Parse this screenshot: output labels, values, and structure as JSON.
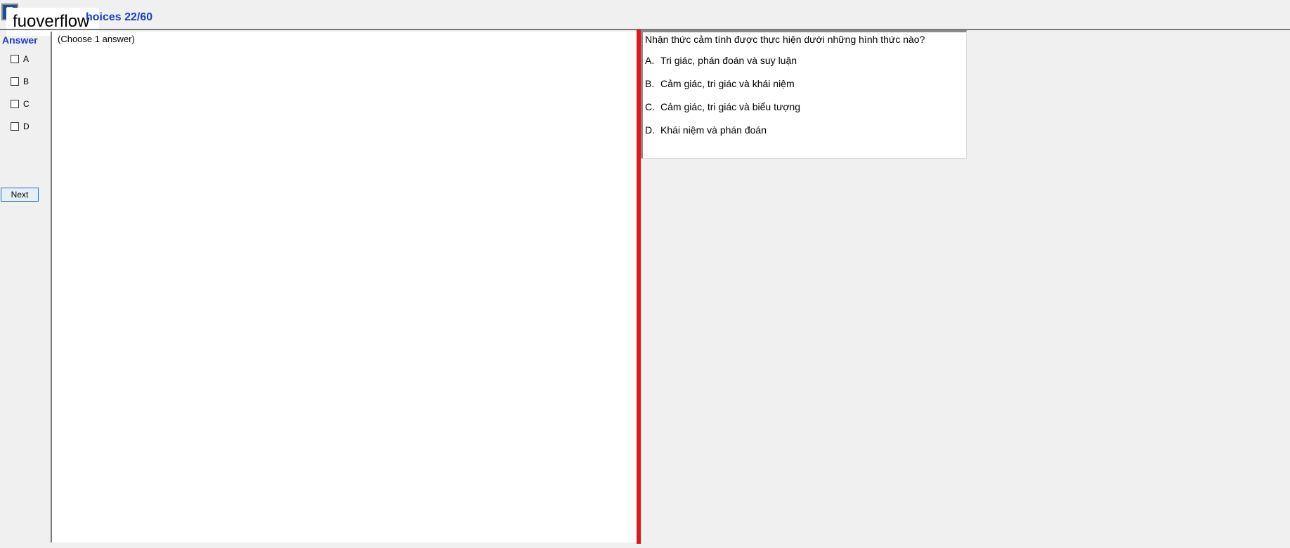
{
  "header": {
    "watermark": "fuoverflow",
    "title": "hoices 22/60"
  },
  "answer_panel": {
    "label": "Answer",
    "options": [
      "A",
      "B",
      "C",
      "D"
    ],
    "next_label": "Next"
  },
  "instruction": "(Choose 1 answer)",
  "question": {
    "text": "Nhận thức cảm tính được thực hiện dưới những hình thức nào?",
    "choices": [
      {
        "letter": "A.",
        "text": "Tri giác, phán đoán và suy luận"
      },
      {
        "letter": "B.",
        "text": "Cảm giác, tri giác và khái niệm"
      },
      {
        "letter": "C.",
        "text": "Cảm giác, tri giác và biểu tượng"
      },
      {
        "letter": "D.",
        "text": "Khái niệm và phán đoán"
      }
    ]
  },
  "colors": {
    "accent_blue": "#1a3fd1",
    "splitter_red": "#e0161b"
  }
}
